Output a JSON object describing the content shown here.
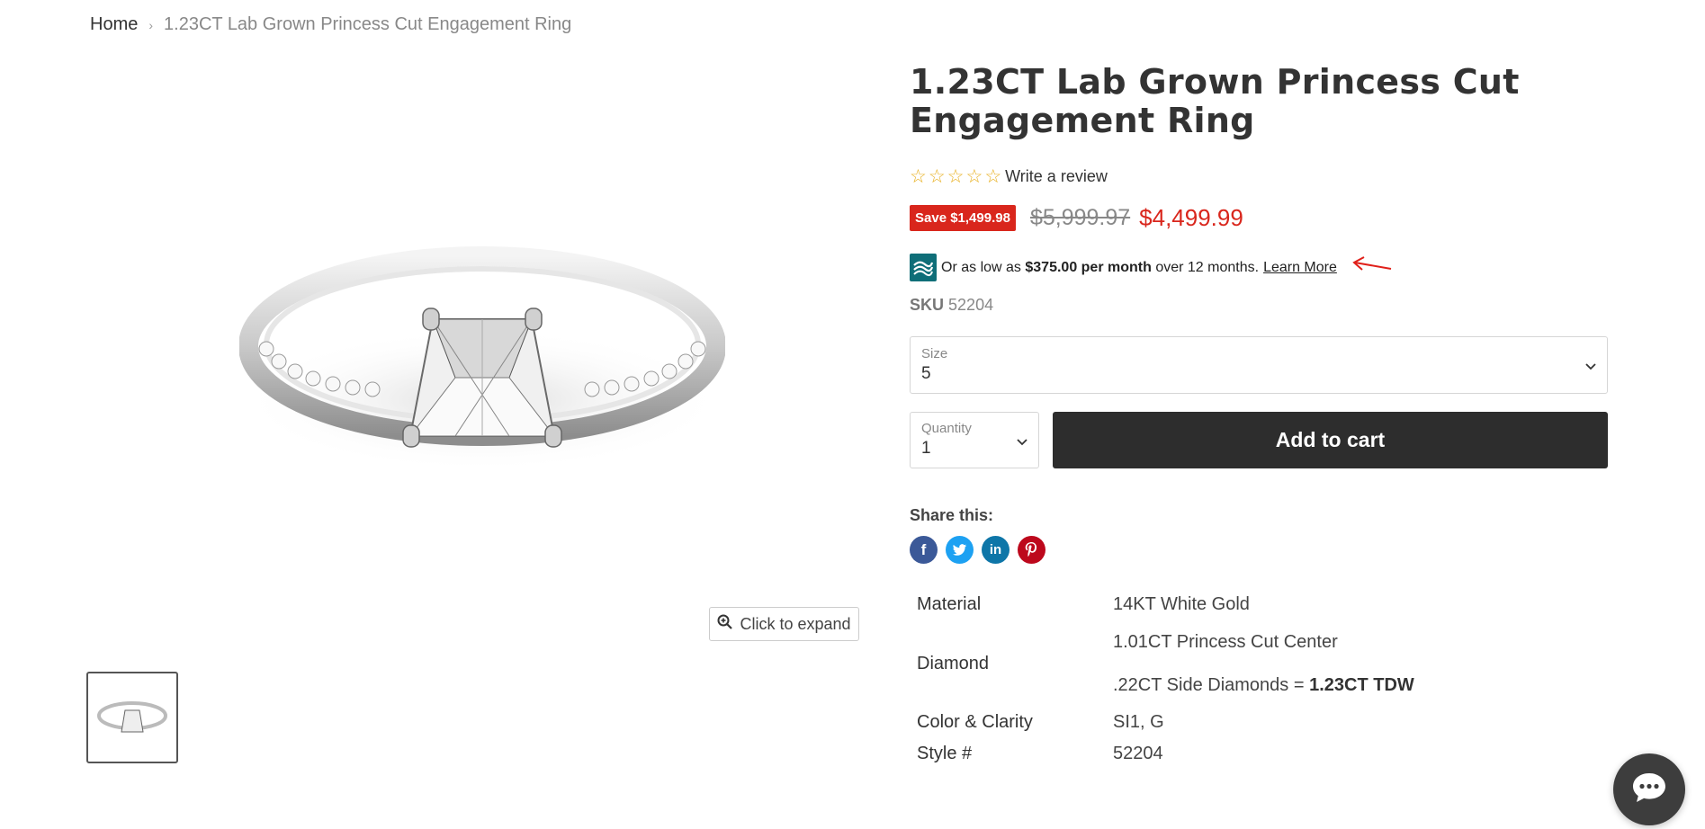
{
  "breadcrumb": {
    "home": "Home",
    "separator": "›",
    "current": "1.23CT Lab Grown Princess Cut Engagement Ring"
  },
  "product": {
    "title": "1.23CT Lab Grown Princess Cut Engagement Ring",
    "rating": {
      "stars": 0,
      "max": 5,
      "write_review": "Write a review"
    },
    "save_badge": "Save $1,499.98",
    "compare_price": "$5,999.97",
    "sale_price": "$4,499.99",
    "financing": {
      "prefix": "Or as low as",
      "amount": "$375.00 per month",
      "term": "over 12 months.",
      "learn_more": "Learn More"
    },
    "sku": {
      "label": "SKU",
      "value": "52204"
    },
    "size": {
      "label": "Size",
      "value": "5"
    },
    "quantity": {
      "label": "Quantity",
      "value": "1"
    },
    "add_to_cart": "Add to cart",
    "share_label": "Share this:",
    "specs": {
      "material": {
        "key": "Material",
        "value": "14KT White Gold"
      },
      "diamond": {
        "key": "Diamond",
        "line1": "1.01CT Princess Cut Center",
        "line2_prefix": ".22CT Side Diamonds =",
        "line2_bold": "1.23CT TDW"
      },
      "color_clarity": {
        "key": "Color & Clarity",
        "value": "SI1, G"
      },
      "style": {
        "key": "Style #",
        "value": "52204"
      }
    }
  },
  "gallery": {
    "expand_label": "Click to expand"
  },
  "colors": {
    "accent_red": "#d9261c",
    "cart_button": "#2d2d2d",
    "finance_logo": "#0f6e78",
    "star": "#e8b020"
  },
  "icons": {
    "facebook": "facebook-icon",
    "twitter": "twitter-icon",
    "linkedin": "linkedin-icon",
    "pinterest": "pinterest-icon",
    "chat": "chat-icon",
    "zoom": "zoom-icon"
  }
}
